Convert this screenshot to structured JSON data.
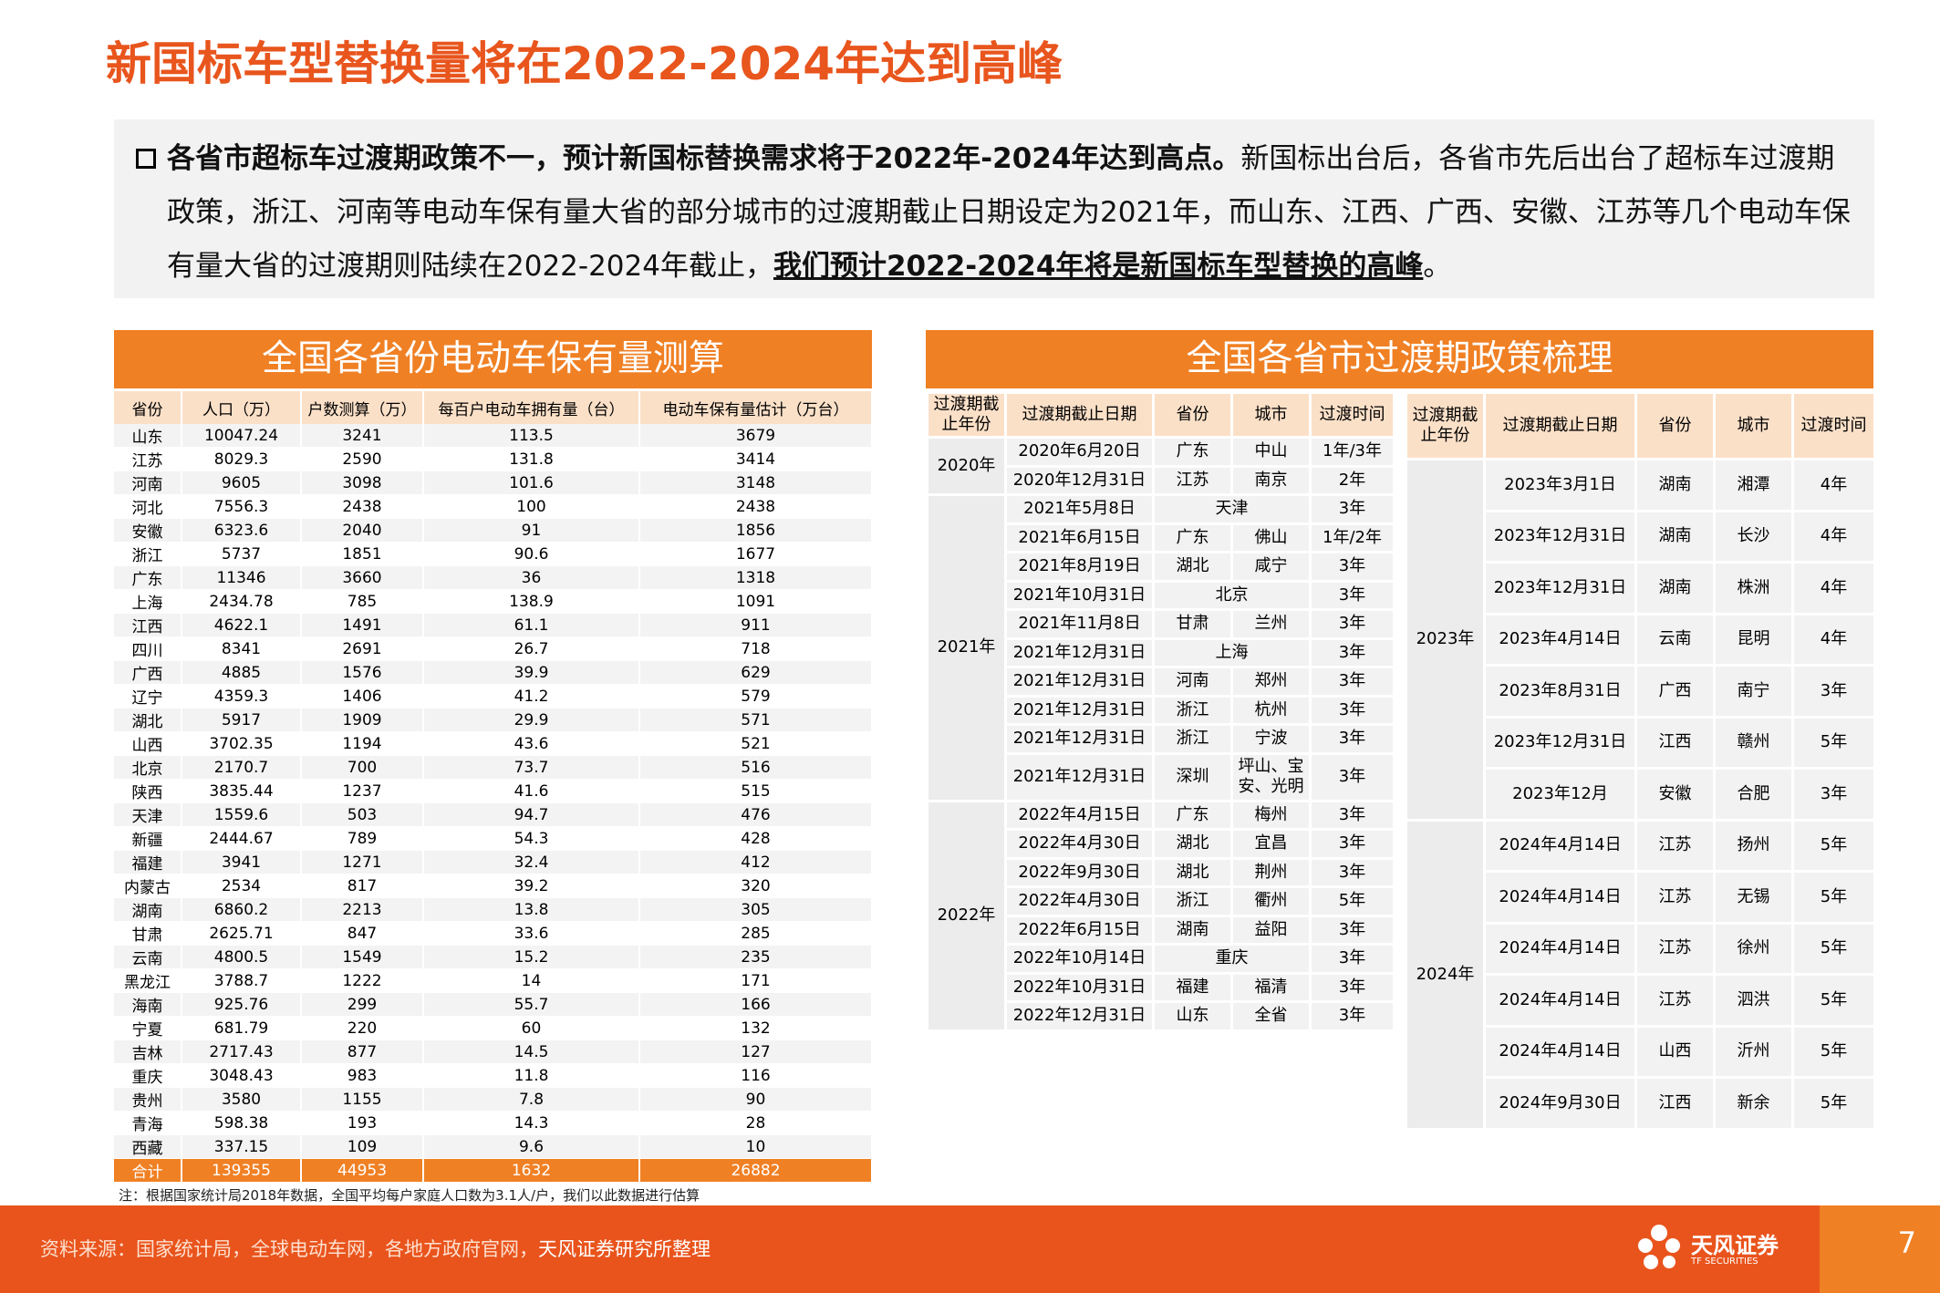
{
  "title": "新国标车型替换量将在2022-2024年达到高峰",
  "intro": {
    "bold": "各省市超标车过渡期政策不一，预计新国标替换需求将于2022年-2024年达到高点。",
    "text": "新国标出台后，各省市先后出台了超标车过渡期政策，浙江、河南等电动车保有量大省的部分城市的过渡期截止日期设定为2021年，而山东、江西、广西、安徽、江苏等几个电动车保有量大省的过渡期则陆续在2022-2024年截止，",
    "underline": "我们预计2022-2024年将是新国标车型替换的高峰",
    "end": "。"
  },
  "left": {
    "banner": "全国各省份电动车保有量测算",
    "headers": [
      "省份",
      "人口（万）",
      "户数测算（万）",
      "每百户电动车拥有量（台）",
      "电动车保有量估计（万台）"
    ],
    "rows": [
      [
        "山东",
        "10047.24",
        "3241",
        "113.5",
        "3679"
      ],
      [
        "江苏",
        "8029.3",
        "2590",
        "131.8",
        "3414"
      ],
      [
        "河南",
        "9605",
        "3098",
        "101.6",
        "3148"
      ],
      [
        "河北",
        "7556.3",
        "2438",
        "100",
        "2438"
      ],
      [
        "安徽",
        "6323.6",
        "2040",
        "91",
        "1856"
      ],
      [
        "浙江",
        "5737",
        "1851",
        "90.6",
        "1677"
      ],
      [
        "广东",
        "11346",
        "3660",
        "36",
        "1318"
      ],
      [
        "上海",
        "2434.78",
        "785",
        "138.9",
        "1091"
      ],
      [
        "江西",
        "4622.1",
        "1491",
        "61.1",
        "911"
      ],
      [
        "四川",
        "8341",
        "2691",
        "26.7",
        "718"
      ],
      [
        "广西",
        "4885",
        "1576",
        "39.9",
        "629"
      ],
      [
        "辽宁",
        "4359.3",
        "1406",
        "41.2",
        "579"
      ],
      [
        "湖北",
        "5917",
        "1909",
        "29.9",
        "571"
      ],
      [
        "山西",
        "3702.35",
        "1194",
        "43.6",
        "521"
      ],
      [
        "北京",
        "2170.7",
        "700",
        "73.7",
        "516"
      ],
      [
        "陕西",
        "3835.44",
        "1237",
        "41.6",
        "515"
      ],
      [
        "天津",
        "1559.6",
        "503",
        "94.7",
        "476"
      ],
      [
        "新疆",
        "2444.67",
        "789",
        "54.3",
        "428"
      ],
      [
        "福建",
        "3941",
        "1271",
        "32.4",
        "412"
      ],
      [
        "内蒙古",
        "2534",
        "817",
        "39.2",
        "320"
      ],
      [
        "湖南",
        "6860.2",
        "2213",
        "13.8",
        "305"
      ],
      [
        "甘肃",
        "2625.71",
        "847",
        "33.6",
        "285"
      ],
      [
        "云南",
        "4800.5",
        "1549",
        "15.2",
        "235"
      ],
      [
        "黑龙江",
        "3788.7",
        "1222",
        "14",
        "171"
      ],
      [
        "海南",
        "925.76",
        "299",
        "55.7",
        "166"
      ],
      [
        "宁夏",
        "681.79",
        "220",
        "60",
        "132"
      ],
      [
        "吉林",
        "2717.43",
        "877",
        "14.5",
        "127"
      ],
      [
        "重庆",
        "3048.43",
        "983",
        "11.8",
        "116"
      ],
      [
        "贵州",
        "3580",
        "1155",
        "7.8",
        "90"
      ],
      [
        "青海",
        "598.38",
        "193",
        "14.3",
        "28"
      ],
      [
        "西藏",
        "337.15",
        "109",
        "9.6",
        "10"
      ]
    ],
    "total": [
      "合计",
      "139355",
      "44953",
      "1632",
      "26882"
    ],
    "note": "注：根据国家统计局2018年数据，全国平均每户家庭人口数为3.1人/户，我们以此数据进行估算"
  },
  "right": {
    "banner": "全国各省市过渡期政策梳理",
    "headers": [
      "过渡期截止年份",
      "过渡期截止日期",
      "省份",
      "城市",
      "过渡时间"
    ],
    "groupA": [
      {
        "year": "2020年",
        "items": [
          [
            "2020年6月20日",
            "广东",
            "中山",
            "1年/3年"
          ],
          [
            "2020年12月31日",
            "江苏",
            "南京",
            "2年"
          ]
        ]
      },
      {
        "year": "2021年",
        "items": [
          [
            "2021年5月8日",
            "天津",
            "",
            "3年"
          ],
          [
            "2021年6月15日",
            "广东",
            "佛山",
            "1年/2年"
          ],
          [
            "2021年8月19日",
            "湖北",
            "咸宁",
            "3年"
          ],
          [
            "2021年10月31日",
            "北京",
            "",
            "3年"
          ],
          [
            "2021年11月8日",
            "甘肃",
            "兰州",
            "3年"
          ],
          [
            "2021年12月31日",
            "上海",
            "",
            "3年"
          ],
          [
            "2021年12月31日",
            "河南",
            "郑州",
            "3年"
          ],
          [
            "2021年12月31日",
            "浙江",
            "杭州",
            "3年"
          ],
          [
            "2021年12月31日",
            "浙江",
            "宁波",
            "3年"
          ],
          [
            "2021年12月31日",
            "深圳",
            "坪山、宝安、光明",
            "3年"
          ]
        ]
      },
      {
        "year": "2022年",
        "items": [
          [
            "2022年4月15日",
            "广东",
            "梅州",
            "3年"
          ],
          [
            "2022年4月30日",
            "湖北",
            "宜昌",
            "3年"
          ],
          [
            "2022年9月30日",
            "湖北",
            "荆州",
            "3年"
          ],
          [
            "2022年4月30日",
            "浙江",
            "衢州",
            "5年"
          ],
          [
            "2022年6月15日",
            "湖南",
            "益阳",
            "3年"
          ],
          [
            "2022年10月14日",
            "重庆",
            "",
            "3年"
          ],
          [
            "2022年10月31日",
            "福建",
            "福清",
            "3年"
          ],
          [
            "2022年12月31日",
            "山东",
            "全省",
            "3年"
          ]
        ]
      }
    ],
    "groupB": [
      {
        "year": "2023年",
        "items": [
          [
            "2023年3月1日",
            "湖南",
            "湘潭",
            "4年"
          ],
          [
            "2023年12月31日",
            "湖南",
            "长沙",
            "4年"
          ],
          [
            "2023年12月31日",
            "湖南",
            "株洲",
            "4年"
          ],
          [
            "2023年4月14日",
            "云南",
            "昆明",
            "4年"
          ],
          [
            "2023年8月31日",
            "广西",
            "南宁",
            "3年"
          ],
          [
            "2023年12月31日",
            "江西",
            "赣州",
            "5年"
          ],
          [
            "2023年12月",
            "安徽",
            "合肥",
            "3年"
          ]
        ]
      },
      {
        "year": "2024年",
        "items": [
          [
            "2024年4月14日",
            "江苏",
            "扬州",
            "5年"
          ],
          [
            "2024年4月14日",
            "江苏",
            "无锡",
            "5年"
          ],
          [
            "2024年4月14日",
            "江苏",
            "徐州",
            "5年"
          ],
          [
            "2024年4月14日",
            "江苏",
            "泗洪",
            "5年"
          ],
          [
            "2024年4月14日",
            "山西",
            "沂州",
            "5年"
          ],
          [
            "2024年9月30日",
            "江西",
            "新余",
            "5年"
          ]
        ]
      }
    ]
  },
  "footer": {
    "source": "资料来源：国家统计局，全球电动车网，各地方政府官网，",
    "source_strong": "天风证券研究所整理",
    "logo_name": "天风证券",
    "logo_sub": "TF SECURITIES",
    "page": "7"
  }
}
